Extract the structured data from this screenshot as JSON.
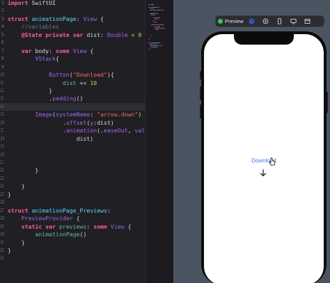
{
  "editor": {
    "lines": [
      {
        "no": "1",
        "tokens": [
          [
            "kw",
            "import"
          ],
          [
            "pl",
            " SwiftUI"
          ]
        ]
      },
      {
        "no": "2",
        "tokens": []
      },
      {
        "no": "3",
        "tokens": [
          [
            "kw",
            "struct"
          ],
          [
            "pl",
            " "
          ],
          [
            "ty",
            "animationPage"
          ],
          [
            "pl",
            ": "
          ],
          [
            "pr",
            "View"
          ],
          [
            "pl",
            " {"
          ]
        ]
      },
      {
        "no": "4",
        "tokens": [
          [
            "cm",
            "    //variables"
          ]
        ]
      },
      {
        "no": "5",
        "tokens": [
          [
            "pl",
            "    "
          ],
          [
            "kw",
            "@State"
          ],
          [
            "pl",
            " "
          ],
          [
            "kw",
            "private"
          ],
          [
            "pl",
            " "
          ],
          [
            "kw",
            "var"
          ],
          [
            "pl",
            " dist: "
          ],
          [
            "pr",
            "Double"
          ],
          [
            "pl",
            " = "
          ],
          [
            "num",
            "0"
          ]
        ]
      },
      {
        "no": "6",
        "tokens": []
      },
      {
        "no": "7",
        "tokens": [
          [
            "pl",
            "    "
          ],
          [
            "kw",
            "var"
          ],
          [
            "pl",
            " body: "
          ],
          [
            "kw",
            "some"
          ],
          [
            "pl",
            " "
          ],
          [
            "pr",
            "View"
          ],
          [
            "pl",
            " {"
          ]
        ]
      },
      {
        "no": "8",
        "tokens": [
          [
            "pl",
            "        "
          ],
          [
            "pr",
            "VStack"
          ],
          [
            "pl",
            "{"
          ]
        ]
      },
      {
        "no": "9",
        "tokens": []
      },
      {
        "no": "10",
        "tokens": [
          [
            "pl",
            "            "
          ],
          [
            "pr",
            "Button"
          ],
          [
            "pl",
            "("
          ],
          [
            "str",
            "\"Download\""
          ],
          [
            "pl",
            "){"
          ]
        ]
      },
      {
        "no": "11",
        "tokens": [
          [
            "pl",
            "                "
          ],
          [
            "fn",
            "dist"
          ],
          [
            "pl",
            " += "
          ],
          [
            "num",
            "10"
          ]
        ]
      },
      {
        "no": "12",
        "tokens": [
          [
            "pl",
            "            }"
          ]
        ]
      },
      {
        "no": "13",
        "tokens": [
          [
            "pl",
            "            ."
          ],
          [
            "pr",
            "padding"
          ],
          [
            "pl",
            "()"
          ]
        ]
      },
      {
        "no": "14",
        "tokens": [],
        "active": true
      },
      {
        "no": "15",
        "tokens": [
          [
            "pl",
            "        "
          ],
          [
            "pr",
            "Image"
          ],
          [
            "pl",
            "("
          ],
          [
            "pr",
            "systemName"
          ],
          [
            "pl",
            ": "
          ],
          [
            "str",
            "\"arrow.down\""
          ],
          [
            "pl",
            ")"
          ]
        ]
      },
      {
        "no": "16",
        "tokens": [
          [
            "pl",
            "                ."
          ],
          [
            "pr",
            "offset"
          ],
          [
            "pl",
            "("
          ],
          [
            "pr",
            "y"
          ],
          [
            "pl",
            ":dist)"
          ]
        ]
      },
      {
        "no": "17",
        "tokens": [
          [
            "pl",
            "                ."
          ],
          [
            "pr",
            "animation"
          ],
          [
            "pl",
            "(."
          ],
          [
            "pr",
            "easeOut"
          ],
          [
            "pl",
            ", "
          ],
          [
            "pr",
            "value"
          ],
          [
            "pl",
            ":"
          ]
        ]
      },
      {
        "no": "18",
        "tokens": [
          [
            "pl",
            "                    dist)"
          ]
        ]
      },
      {
        "no": "19",
        "tokens": []
      },
      {
        "no": "20",
        "tokens": []
      },
      {
        "no": "21",
        "tokens": []
      },
      {
        "no": "22",
        "tokens": [
          [
            "pl",
            "        }"
          ]
        ]
      },
      {
        "no": "23",
        "tokens": []
      },
      {
        "no": "24",
        "tokens": [
          [
            "pl",
            "    }"
          ]
        ]
      },
      {
        "no": "25",
        "tokens": [
          [
            "pl",
            "}"
          ]
        ]
      },
      {
        "no": "26",
        "tokens": []
      },
      {
        "no": "27",
        "tokens": [
          [
            "kw",
            "struct"
          ],
          [
            "pl",
            " "
          ],
          [
            "ty",
            "animationPage_Previews"
          ],
          [
            "pl",
            ":"
          ]
        ]
      },
      {
        "no": "28",
        "tokens": [
          [
            "pl",
            "    "
          ],
          [
            "pr",
            "PreviewProvider"
          ],
          [
            "pl",
            " {"
          ]
        ]
      },
      {
        "no": "29",
        "tokens": [
          [
            "pl",
            "    "
          ],
          [
            "kw",
            "static"
          ],
          [
            "pl",
            " "
          ],
          [
            "kw",
            "var"
          ],
          [
            "pl",
            " "
          ],
          [
            "fn",
            "previews"
          ],
          [
            "pl",
            ": "
          ],
          [
            "kw",
            "some"
          ],
          [
            "pl",
            " "
          ],
          [
            "pr",
            "View"
          ],
          [
            "pl",
            " {"
          ]
        ]
      },
      {
        "no": "30",
        "tokens": [
          [
            "pl",
            "        "
          ],
          [
            "fn",
            "animationPage"
          ],
          [
            "pl",
            "()"
          ]
        ]
      },
      {
        "no": "31",
        "tokens": [
          [
            "pl",
            "    }"
          ]
        ]
      },
      {
        "no": "32",
        "tokens": [
          [
            "pl",
            "}"
          ]
        ]
      },
      {
        "no": "33",
        "tokens": []
      }
    ]
  },
  "preview": {
    "label": "Preview",
    "download_label": "Download",
    "icons": [
      "live-preview-icon",
      "inspect-icon",
      "variants-icon",
      "device-icon",
      "settings-icon"
    ]
  },
  "colors": {
    "accent": "#2f7cf6",
    "live": "#3fc15a",
    "canvas": "#4b5461"
  }
}
